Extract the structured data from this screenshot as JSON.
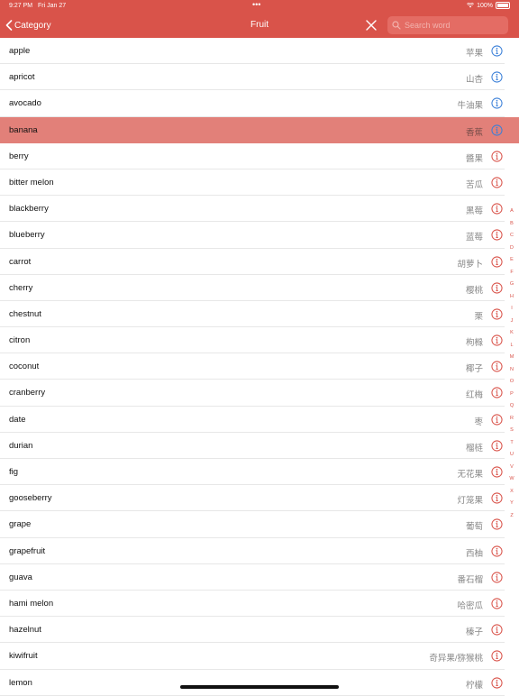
{
  "status": {
    "time": "9:27 PM",
    "date": "Fri Jan 27",
    "battery": "100%"
  },
  "nav": {
    "back_label": "Category",
    "title": "Fruit",
    "search_placeholder": "Search word"
  },
  "colors": {
    "accent": "#d9534a",
    "info_blue": "#3a7fd8",
    "info_red": "#d9534a",
    "selected_row": "#e28079"
  },
  "words": [
    {
      "en": "apple",
      "zh": "苹果",
      "icon": "info-blue"
    },
    {
      "en": "apricot",
      "zh": "山杏",
      "icon": "info-blue"
    },
    {
      "en": "avocado",
      "zh": "牛油果",
      "icon": "info-blue"
    },
    {
      "en": "banana",
      "zh": "香蕉",
      "icon": "info-blue",
      "selected": true
    },
    {
      "en": "berry",
      "zh": "醬果",
      "icon": "info-red"
    },
    {
      "en": "bitter melon",
      "zh": "苦瓜",
      "icon": "info-red"
    },
    {
      "en": "blackberry",
      "zh": "黑莓",
      "icon": "info-red"
    },
    {
      "en": "blueberry",
      "zh": "蓝莓",
      "icon": "info-red"
    },
    {
      "en": "carrot",
      "zh": "胡萝卜",
      "icon": "info-red"
    },
    {
      "en": "cherry",
      "zh": "樱桃",
      "icon": "info-red"
    },
    {
      "en": "chestnut",
      "zh": "栗",
      "icon": "info-red"
    },
    {
      "en": "citron",
      "zh": "枸橼",
      "icon": "info-red"
    },
    {
      "en": "coconut",
      "zh": "椰子",
      "icon": "info-red"
    },
    {
      "en": "cranberry",
      "zh": "红梅",
      "icon": "info-red"
    },
    {
      "en": "date",
      "zh": "枣",
      "icon": "info-red"
    },
    {
      "en": "durian",
      "zh": "榴梿",
      "icon": "info-red"
    },
    {
      "en": "fig",
      "zh": "无花果",
      "icon": "info-red"
    },
    {
      "en": "gooseberry",
      "zh": "灯笼果",
      "icon": "info-red"
    },
    {
      "en": "grape",
      "zh": "葡萄",
      "icon": "info-red"
    },
    {
      "en": "grapefruit",
      "zh": "西柚",
      "icon": "info-red"
    },
    {
      "en": "guava",
      "zh": "番石榴",
      "icon": "info-red"
    },
    {
      "en": "hami melon",
      "zh": "哈密瓜",
      "icon": "info-red"
    },
    {
      "en": "hazelnut",
      "zh": "榛子",
      "icon": "info-red"
    },
    {
      "en": "kiwifruit",
      "zh": "奇异果/猕猴桃",
      "icon": "info-red"
    },
    {
      "en": "lemon",
      "zh": "柠檬",
      "icon": "info-red"
    }
  ],
  "index_letters": [
    "A",
    "B",
    "C",
    "D",
    "E",
    "F",
    "G",
    "H",
    "I",
    "J",
    "K",
    "L",
    "M",
    "N",
    "O",
    "P",
    "Q",
    "R",
    "S",
    "T",
    "U",
    "V",
    "W",
    "X",
    "Y",
    "Z"
  ]
}
